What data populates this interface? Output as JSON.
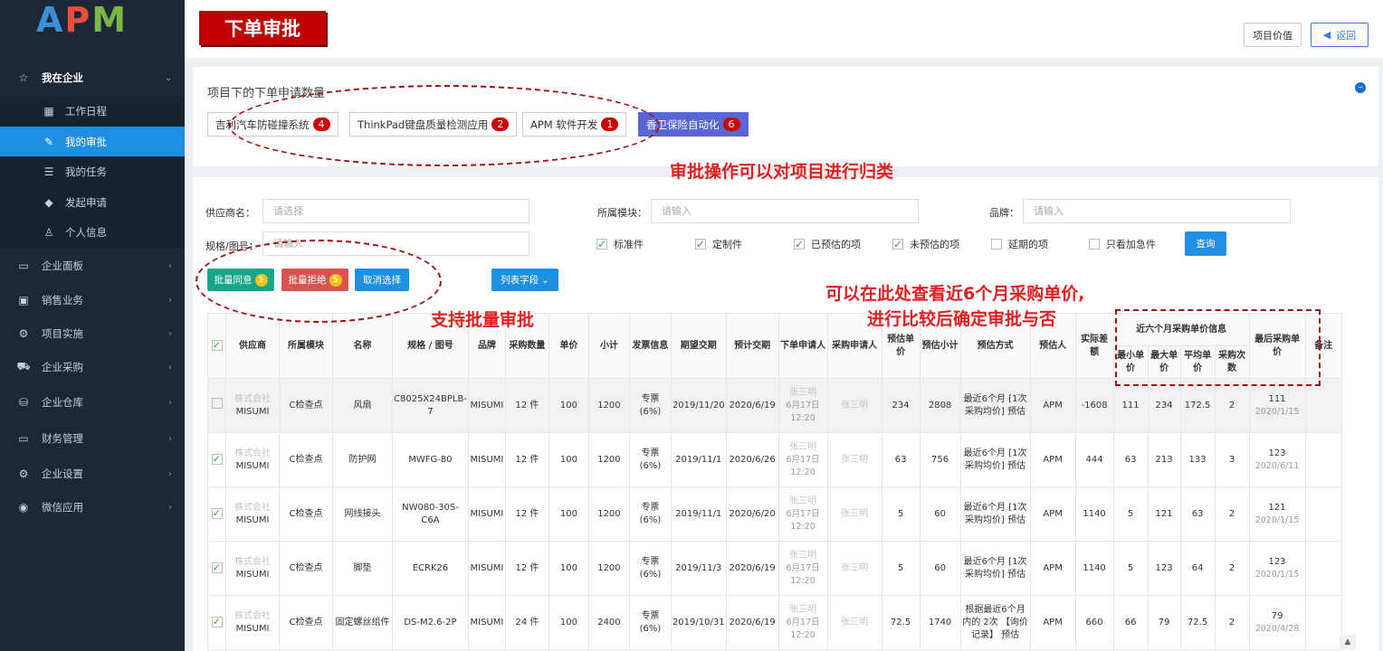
{
  "logo": {
    "a": "A",
    "p": "P",
    "m": "M"
  },
  "sidebar": {
    "items": [
      {
        "label": "我在企业",
        "icon": "star-icon",
        "expanded": true
      },
      {
        "label": "工作日程",
        "icon": "calendar-icon"
      },
      {
        "label": "我的审批",
        "icon": "pencil-icon",
        "active": true
      },
      {
        "label": "我的任务",
        "icon": "tasks-icon"
      },
      {
        "label": "发起申请",
        "icon": "tag-icon"
      },
      {
        "label": "个人信息",
        "icon": "user-icon"
      },
      {
        "label": "企业面板",
        "icon": "monitor-icon"
      },
      {
        "label": "销售业务",
        "icon": "briefcase-icon"
      },
      {
        "label": "项目实施",
        "icon": "gears-icon"
      },
      {
        "label": "企业采购",
        "icon": "cart-icon"
      },
      {
        "label": "企业仓库",
        "icon": "database-icon"
      },
      {
        "label": "财务管理",
        "icon": "monitor-icon"
      },
      {
        "label": "企业设置",
        "icon": "gear-icon"
      },
      {
        "label": "微信应用",
        "icon": "wechat-icon"
      }
    ]
  },
  "header": {
    "title": "下单审批",
    "value_btn": "项目价值",
    "back_btn": "返回"
  },
  "projects": {
    "heading": "项目下的下单申请数量",
    "tags": [
      {
        "label": "吉利汽车防碰撞系统",
        "count": "4"
      },
      {
        "label": "ThinkPad键盘质量检测应用",
        "count": "2"
      },
      {
        "label": "APM 软件开发",
        "count": "1"
      },
      {
        "label": "香卫保险自动化",
        "count": "6",
        "selected": true
      }
    ]
  },
  "filters": {
    "supplier_label": "供应商名：",
    "supplier_ph": "请选择",
    "module_label": "所属模块：",
    "module_ph": "请输入",
    "brand_label": "品牌：",
    "brand_ph": "请输入",
    "spec_label": "规格/图号：",
    "spec_ph": "请输入",
    "checks": [
      {
        "label": "标准件",
        "checked": true
      },
      {
        "label": "定制件",
        "checked": true
      },
      {
        "label": "已预估的项",
        "checked": true
      },
      {
        "label": "未预估的项",
        "checked": true
      },
      {
        "label": "延期的项",
        "checked": false
      },
      {
        "label": "只看加急件",
        "checked": false
      }
    ],
    "query_btn": "查询"
  },
  "actions": {
    "approve": "批量同意",
    "approve_count": "5",
    "reject": "批量拒绝",
    "reject_count": "5",
    "cancel": "取消选择",
    "columns": "列表字段"
  },
  "table": {
    "headers": [
      "供应商",
      "所属模块",
      "名称",
      "规格 / 图号",
      "品牌",
      "采购数量",
      "单价",
      "小计",
      "发票信息",
      "期望交期",
      "预计交期",
      "下单申请人",
      "采购申请人",
      "预估单价",
      "预估小计",
      "预估方式",
      "预估人",
      "实际差额",
      "近六个月采购单价信息",
      "最后采购单价",
      "备注"
    ],
    "sub_headers": [
      "最小单价",
      "最大单价",
      "平均单价",
      "采购次数"
    ],
    "rows": [
      {
        "supplier": "株式会社",
        "supplier2": "MISUMI",
        "module": "C检查点",
        "name": "风扇",
        "spec": "C8025X24BPLB-7",
        "brand": "MISUMI",
        "qty": "12 件",
        "price": "100",
        "subtotal": "1200",
        "invoice": "专票(6%)",
        "expect": "2019/11/20",
        "plan": "2020/6/19",
        "applicant": "张三明",
        "app_date": "6月17日",
        "app_time": "12:20",
        "purchaser": "张三明",
        "est_price": "234",
        "est_sub": "2808",
        "est_way": "最近6个月 [1次采购均价] 预估",
        "estimator": "APM",
        "diff": "-1608",
        "min": "111",
        "max": "234",
        "avg": "172.5",
        "times": "2",
        "last": "111",
        "last_date": "2020/1/15",
        "checked": false
      },
      {
        "supplier": "株式会社",
        "supplier2": "MISUMI",
        "module": "C检查点",
        "name": "防护网",
        "spec": "MWFG-80",
        "brand": "MISUMI",
        "qty": "12 件",
        "price": "100",
        "subtotal": "1200",
        "invoice": "专票(6%)",
        "expect": "2019/11/1",
        "plan": "2020/6/26",
        "applicant": "张三明",
        "app_date": "6月17日",
        "app_time": "12:20",
        "purchaser": "张三明",
        "est_price": "63",
        "est_sub": "756",
        "est_way": "最近6个月 [1次采购均价] 预估",
        "estimator": "APM",
        "diff": "444",
        "min": "63",
        "max": "213",
        "avg": "133",
        "times": "3",
        "last": "123",
        "last_date": "2020/6/11",
        "checked": true
      },
      {
        "supplier": "株式会社",
        "supplier2": "MISUMI",
        "module": "C检查点",
        "name": "网线接头",
        "spec": "NW080-30S-C6A",
        "brand": "MISUMI",
        "qty": "12 件",
        "price": "100",
        "subtotal": "1200",
        "invoice": "专票(6%)",
        "expect": "2019/11/1",
        "plan": "2020/6/20",
        "applicant": "张三明",
        "app_date": "6月17日",
        "app_time": "12:20",
        "purchaser": "张三明",
        "est_price": "5",
        "est_sub": "60",
        "est_way": "最近6个月 [1次采购均价] 预估",
        "estimator": "APM",
        "diff": "1140",
        "min": "5",
        "max": "121",
        "avg": "63",
        "times": "2",
        "last": "121",
        "last_date": "2020/1/15",
        "checked": true
      },
      {
        "supplier": "株式会社",
        "supplier2": "MISUMI",
        "module": "C检查点",
        "name": "脚垫",
        "spec": "ECRK26",
        "brand": "MISUMI",
        "qty": "12 件",
        "price": "100",
        "subtotal": "1200",
        "invoice": "专票(6%)",
        "expect": "2019/11/3",
        "plan": "2020/6/19",
        "applicant": "张三明",
        "app_date": "6月17日",
        "app_time": "12:20",
        "purchaser": "张三明",
        "est_price": "5",
        "est_sub": "60",
        "est_way": "最近6个月 [1次采购均价] 预估",
        "estimator": "APM",
        "diff": "1140",
        "min": "5",
        "max": "123",
        "avg": "64",
        "times": "2",
        "last": "123",
        "last_date": "2020/1/15",
        "checked": true
      },
      {
        "supplier": "株式会社",
        "supplier2": "MISUMI",
        "module": "C检查点",
        "name": "固定螺丝组件",
        "spec": "DS-M2.6-2P",
        "brand": "MISUMI",
        "qty": "24 件",
        "price": "100",
        "subtotal": "2400",
        "invoice": "专票(6%)",
        "expect": "2019/10/31",
        "plan": "2020/6/19",
        "applicant": "张三明",
        "app_date": "6月17日",
        "app_time": "12:20",
        "purchaser": "张三明",
        "est_price": "72.5",
        "est_sub": "1740",
        "est_way": "根据最近6个月内的 2次 【询价记录】 预估",
        "estimator": "APM",
        "diff": "660",
        "min": "66",
        "max": "79",
        "avg": "72.5",
        "times": "2",
        "last": "79",
        "last_date": "2020/4/28",
        "checked": true
      }
    ]
  },
  "annotations": {
    "classify": "审批操作可以对项目进行归类",
    "batch": "支持批量审批",
    "price_line1": "可以在此处查看近6个月采购单价,",
    "price_line2": "进行比较后确定审批与否"
  },
  "colors": {
    "accent": "#1e8fe1",
    "title_bg": "#c00000",
    "annotation": "#e02020",
    "approve": "#18a689",
    "reject": "#d9534f",
    "cancel": "#1e8fe1"
  }
}
